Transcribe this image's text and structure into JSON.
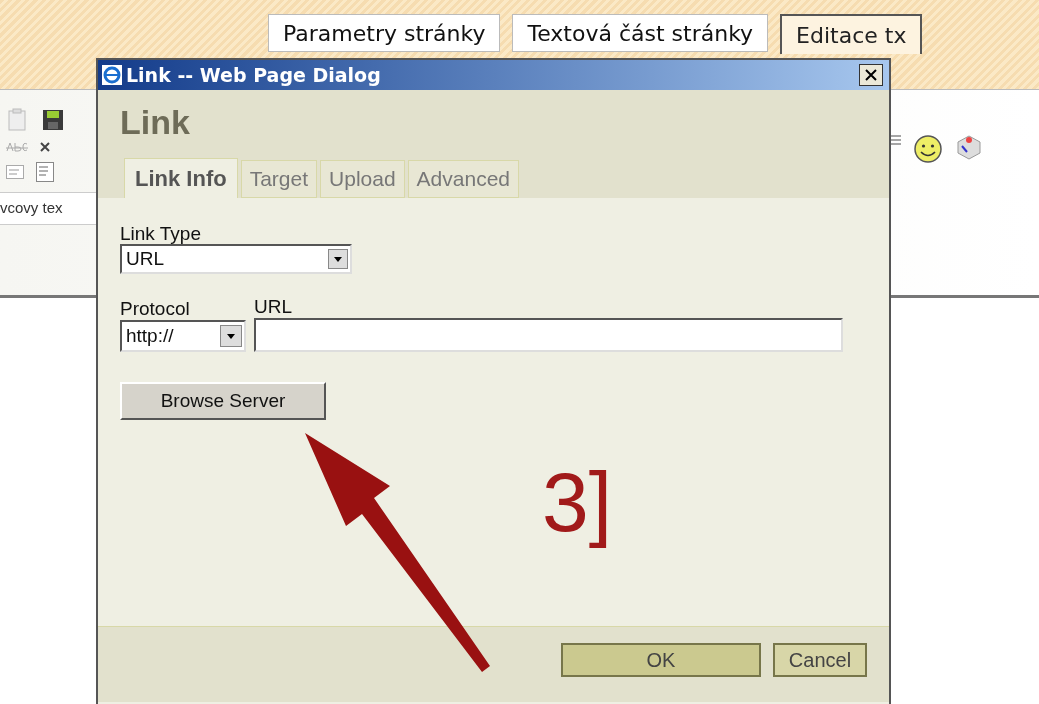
{
  "page_tabs": [
    {
      "label": "Parametry stránky",
      "selected": false
    },
    {
      "label": "Textová část stránky",
      "selected": false
    },
    {
      "label": "Editace tx",
      "selected": true
    }
  ],
  "editor": {
    "style_field": "vcovy tex"
  },
  "dialog": {
    "title": "Link -- Web Page Dialog",
    "heading": "Link",
    "tabs": [
      {
        "label": "Link Info",
        "selected": true
      },
      {
        "label": "Target",
        "selected": false
      },
      {
        "label": "Upload",
        "selected": false
      },
      {
        "label": "Advanced",
        "selected": false
      }
    ],
    "link_type": {
      "label": "Link Type",
      "value": "URL"
    },
    "protocol": {
      "label": "Protocol",
      "value": "http://"
    },
    "url": {
      "label": "URL"
    },
    "browse_button": "Browse Server",
    "footer_buttons": [
      {
        "label": "OK",
        "kind": "primary"
      },
      {
        "label": "Cancel",
        "kind": "secondary"
      }
    ]
  },
  "annotation": "3]"
}
